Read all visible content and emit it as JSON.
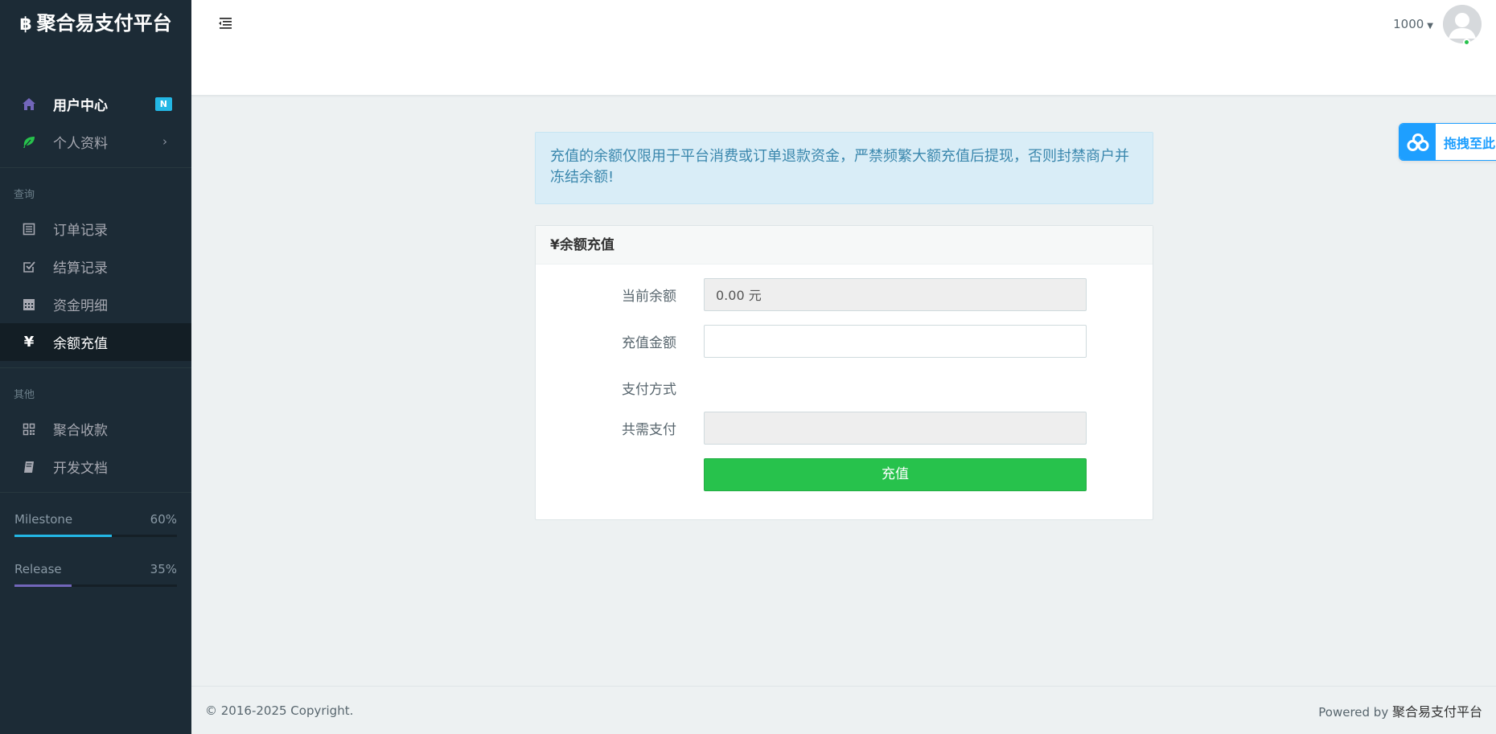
{
  "brand": {
    "title": "聚合易支付平台",
    "icon": "bitcoin-icon"
  },
  "sidebar": {
    "items_top": [
      {
        "label": "用户中心",
        "icon": "home-icon",
        "badge": "N"
      },
      {
        "label": "个人资料",
        "icon": "leaf-icon"
      }
    ],
    "section_query": "查询",
    "items_query": [
      {
        "label": "订单记录",
        "icon": "list-icon"
      },
      {
        "label": "结算记录",
        "icon": "check-square-icon"
      },
      {
        "label": "资金明细",
        "icon": "calendar-icon"
      },
      {
        "label": "余额充值",
        "icon": "yen-icon"
      }
    ],
    "section_other": "其他",
    "items_other": [
      {
        "label": "聚合收款",
        "icon": "qrcode-icon"
      },
      {
        "label": "开发文档",
        "icon": "book-icon"
      }
    ],
    "progress": [
      {
        "label": "Milestone",
        "value_text": "60%",
        "value": 0.6,
        "color": "#23b7e5"
      },
      {
        "label": "Release",
        "value_text": "35%",
        "value": 0.35,
        "color": "#7266ba"
      }
    ]
  },
  "header": {
    "username": "1000"
  },
  "alert": {
    "text": "充值的余额仅限用于平台消费或订单退款资金，严禁频繁大额充值后提现，否则封禁商户并冻结余额!"
  },
  "panel": {
    "title": "¥余额充值",
    "fields": {
      "balance_label": "当前余额",
      "balance_value": "0.00 元",
      "amount_label": "充值金额",
      "amount_value": "",
      "paymethod_label": "支付方式",
      "total_label": "共需支付",
      "total_value": ""
    },
    "submit_label": "充值"
  },
  "float_widget": {
    "label": "拖拽至此"
  },
  "footer": {
    "copyright": "© 2016-2025 Copyright.",
    "powered_prefix": "Powered by ",
    "powered_brand": "聚合易支付平台"
  }
}
